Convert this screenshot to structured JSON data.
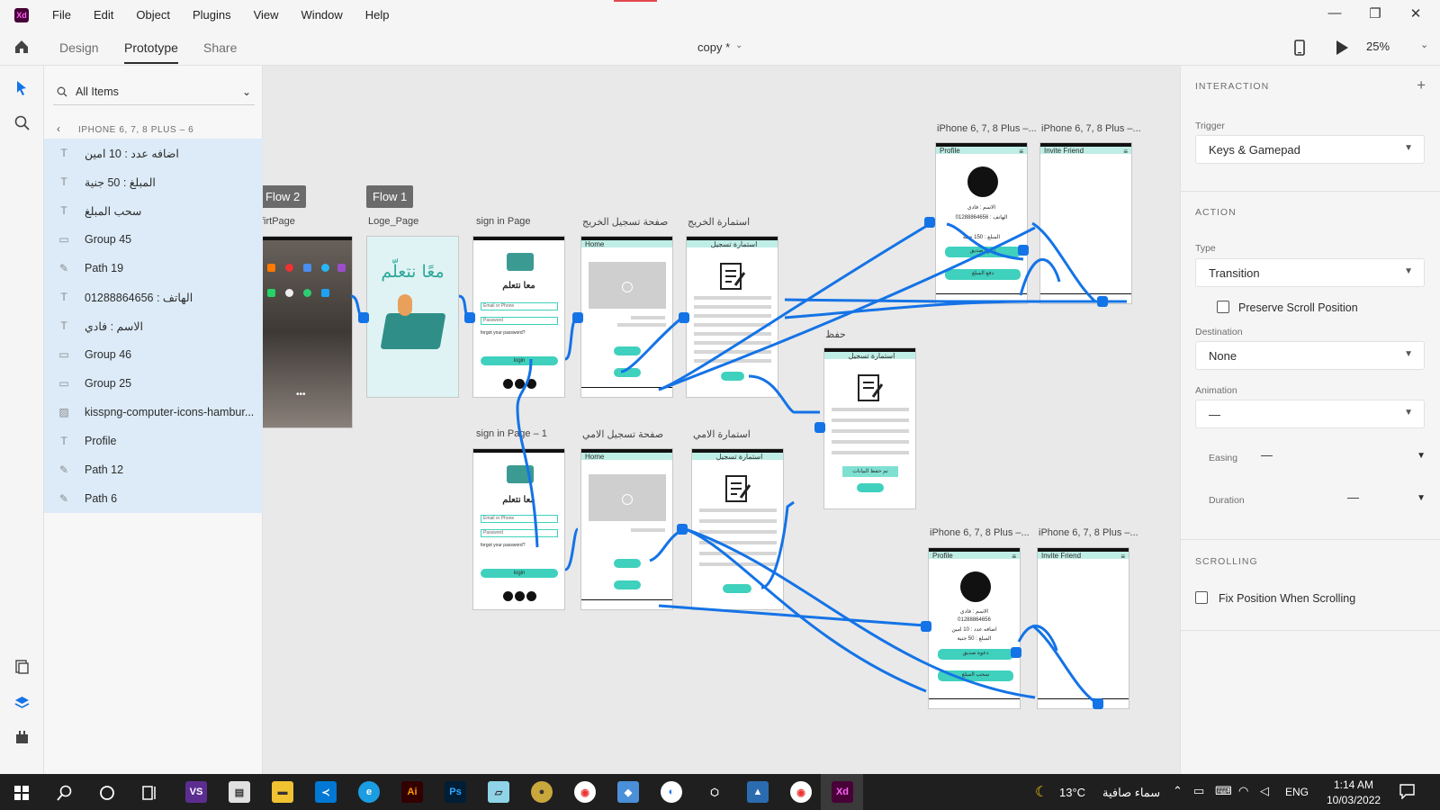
{
  "app": {
    "logo": "Xd",
    "menu": [
      "File",
      "Edit",
      "Object",
      "Plugins",
      "View",
      "Window",
      "Help"
    ],
    "window_controls": {
      "minimize": "—",
      "restore": "❐",
      "close": "✕"
    }
  },
  "toolbar": {
    "tabs": [
      "Design",
      "Prototype",
      "Share"
    ],
    "active_tab": "Prototype",
    "doc_title": "copy *",
    "zoom": "25%"
  },
  "layers": {
    "search_placeholder": "All Items",
    "breadcrumb": "IPHONE 6, 7, 8 PLUS – 6",
    "items": [
      {
        "type": "text",
        "label": "اضافه عدد :   10   امين"
      },
      {
        "type": "text",
        "label": "المبلغ : 50 جنية"
      },
      {
        "type": "text",
        "label": "سحب المبلغ"
      },
      {
        "type": "group",
        "label": "Group 45"
      },
      {
        "type": "path",
        "label": "Path 19"
      },
      {
        "type": "text",
        "label": "الهاتف : 01288864656"
      },
      {
        "type": "text",
        "label": "الاسم : فادي"
      },
      {
        "type": "group",
        "label": "Group 46"
      },
      {
        "type": "group",
        "label": "Group 25"
      },
      {
        "type": "image",
        "label": "kisspng-computer-icons-hambur..."
      },
      {
        "type": "text",
        "label": "Profile"
      },
      {
        "type": "path",
        "label": "Path 12"
      },
      {
        "type": "path",
        "label": "Path 6"
      }
    ]
  },
  "canvas": {
    "flows": [
      "Flow 2",
      "Flow 1"
    ],
    "artboards": [
      {
        "id": "first",
        "label": "firtPage"
      },
      {
        "id": "loge",
        "label": "Loge_Page",
        "heading": "معًا نتعلّم"
      },
      {
        "id": "signin",
        "label": "sign in Page",
        "heading": "معا نتعلم",
        "email": "Email or Phone",
        "password": "Password",
        "forgot": "forgot your password?",
        "login": "login"
      },
      {
        "id": "grad_reg",
        "label": "صفحة تسجيل الخريج",
        "header": "Home"
      },
      {
        "id": "grad_form",
        "label": "استمارة الخريج",
        "header": "استمارة تسجيل"
      },
      {
        "id": "signin2",
        "label": "sign in Page – 1",
        "heading": "معا نتعلم",
        "email": "Email or Phone",
        "password": "Password",
        "forgot": "forgot your password?",
        "login": "login"
      },
      {
        "id": "illit_reg",
        "label": "صفحة تسجيل الامي",
        "header": "Home"
      },
      {
        "id": "illit_form",
        "label": "استمارة الامي",
        "header": "استمارة تسجيل"
      },
      {
        "id": "save",
        "label": "حفظ",
        "header": "استمارة تسجيل",
        "saved": "تم حفظ البيانات"
      },
      {
        "id": "profile1",
        "label": "iPhone 6, 7, 8 Plus –...",
        "header": "Profile",
        "name": "الاسم : فادي",
        "phone": "الهاتف : 01288864656",
        "amount": "المبلغ : 150 جنية",
        "invite": "دعوة صديق",
        "withdraw": "دفع المبلغ"
      },
      {
        "id": "invite1",
        "label": "iPhone 6, 7, 8 Plus –...",
        "header": "Invite Friend"
      },
      {
        "id": "profile2",
        "label": "iPhone 6, 7, 8 Plus –...",
        "header": "Profile",
        "name": "الاسم : فادي",
        "phone": "01288864656",
        "count": "اضافه عدد : 10 امين",
        "amount": "المبلغ : 50 جنية",
        "invite": "دعوة صديق",
        "withdraw": "سحب المبلغ"
      },
      {
        "id": "invite2",
        "label": "iPhone 6, 7, 8 Plus –...",
        "header": "Invite Friend"
      }
    ]
  },
  "inspector": {
    "interaction_title": "INTERACTION",
    "trigger_label": "Trigger",
    "trigger_value": "Keys & Gamepad",
    "action_title": "ACTION",
    "type_label": "Type",
    "type_value": "Transition",
    "preserve_scroll": "Preserve Scroll Position",
    "destination_label": "Destination",
    "destination_value": "None",
    "animation_label": "Animation",
    "animation_value": "—",
    "easing_label": "Easing",
    "easing_value": "—",
    "duration_label": "Duration",
    "duration_value": "—",
    "scrolling_title": "SCROLLING",
    "fix_position": "Fix Position When Scrolling"
  },
  "taskbar": {
    "weather_temp": "13°C",
    "weather_text": "سماء صافية",
    "lang": "ENG",
    "time": "1:14 AM",
    "date": "10/03/2022"
  },
  "colors": {
    "accent": "#1473e6",
    "teal": "#3fd1bd",
    "xd_purple": "#470137"
  }
}
